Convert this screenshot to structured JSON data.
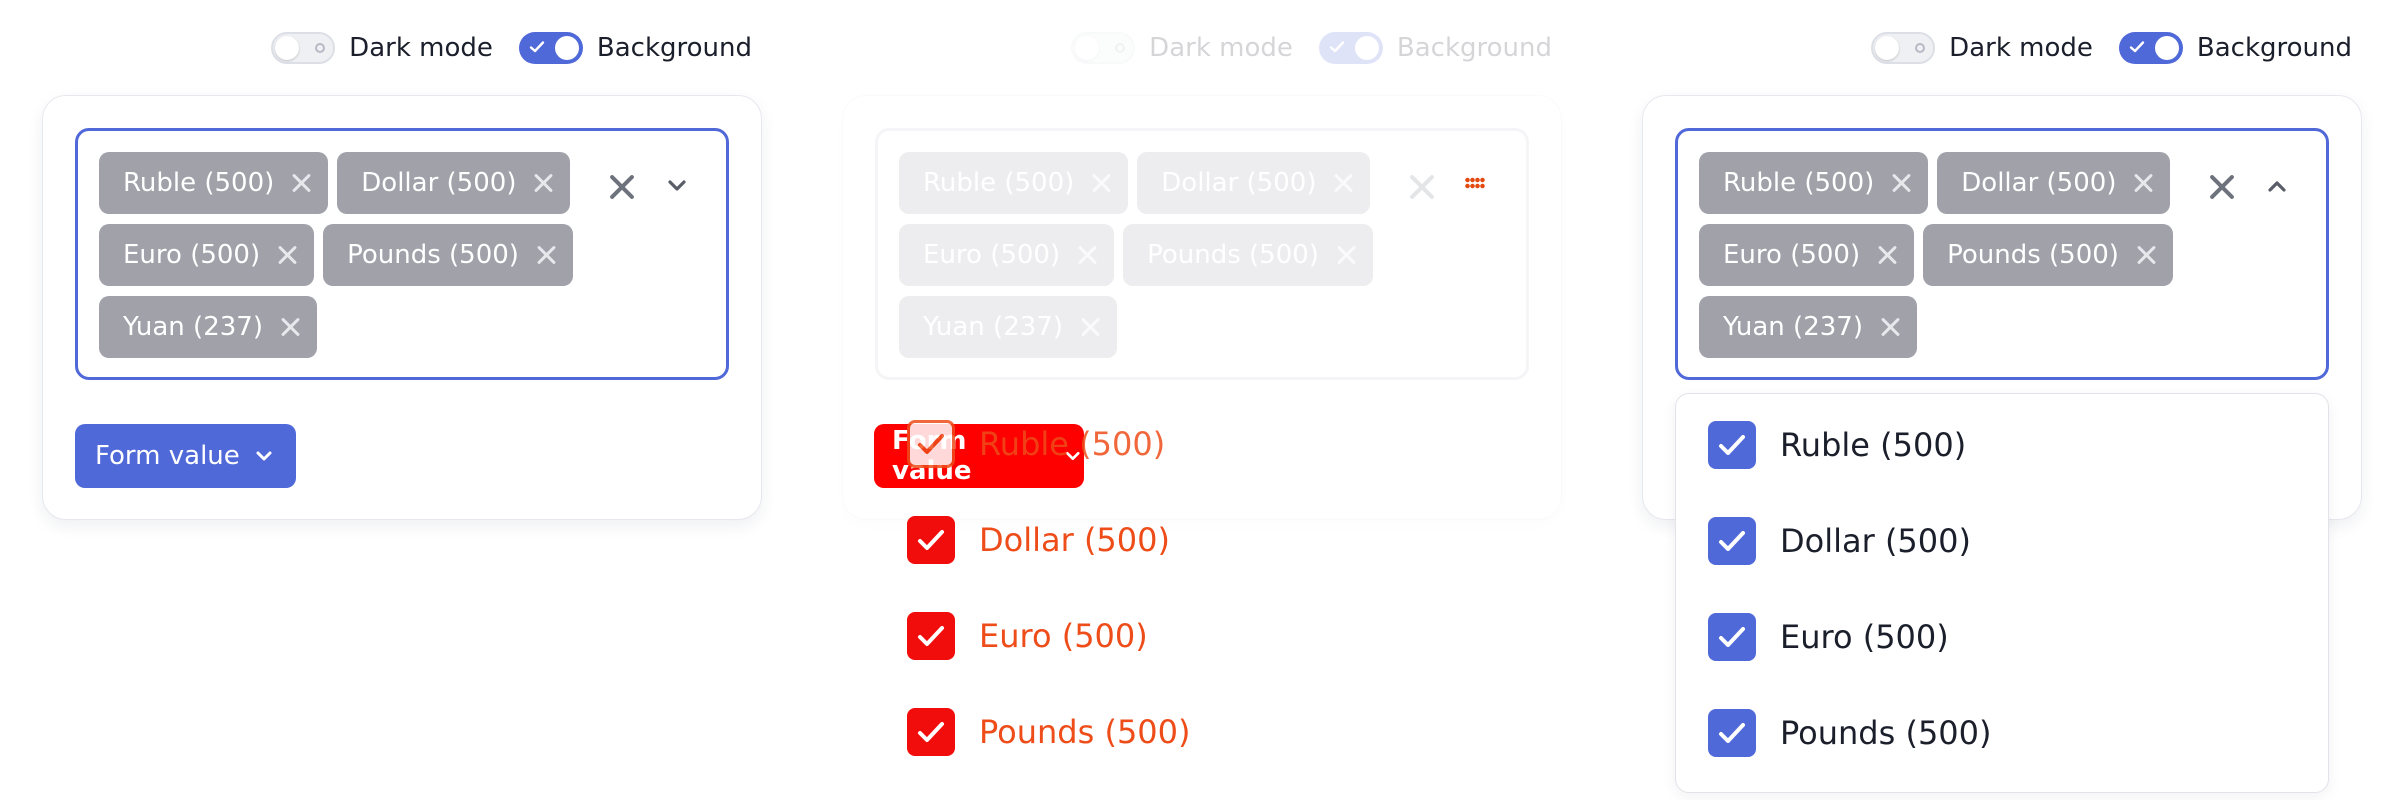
{
  "toggles": {
    "dark_mode_label": "Dark mode",
    "background_label": "Background"
  },
  "chips": [
    "Ruble (500)",
    "Dollar (500)",
    "Euro (500)",
    "Pounds (500)",
    "Yuan (237)"
  ],
  "form_button_label": "Form value",
  "options": [
    "Ruble (500)",
    "Dollar (500)",
    "Euro (500)",
    "Pounds (500)"
  ],
  "colors": {
    "accent": "#5069d9",
    "chip": "#a0a1a9",
    "debug_red": "#ff0000",
    "debug_text": "#ee4d1a"
  },
  "icons": {
    "clear": "close-icon",
    "collapsed": "chevron-down-icon",
    "expanded": "chevron-up-icon",
    "option": "checkmark-icon",
    "menu_marker": "grid-dots-icon"
  }
}
